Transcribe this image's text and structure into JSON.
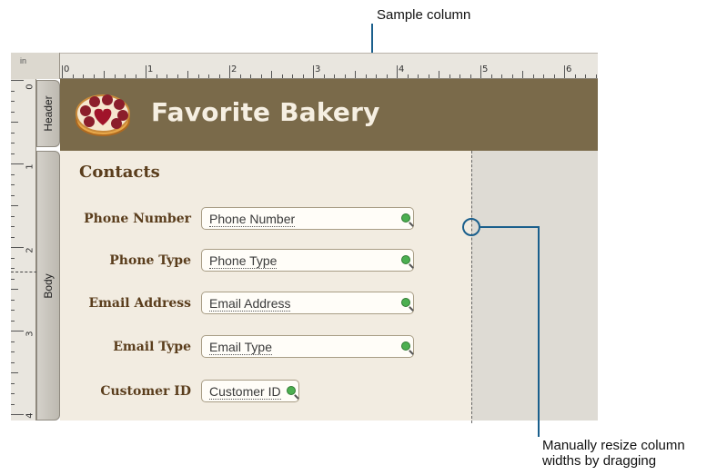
{
  "annotations": {
    "top_callout": "Sample column",
    "bottom_callout_line1": "Manually resize column",
    "bottom_callout_line2": "widths by dragging"
  },
  "ruler": {
    "unit": "in",
    "horizontal": [
      "0",
      "1",
      "2",
      "3",
      "4",
      "5",
      "6"
    ],
    "vertical": [
      "0",
      "1",
      "2",
      "3",
      "4"
    ]
  },
  "sections": {
    "header": "Header",
    "body": "Body"
  },
  "header": {
    "title": "Favorite Bakery",
    "logo_icon": "pie-icon"
  },
  "body": {
    "heading": "Contacts",
    "fields": [
      {
        "label": "Phone Number",
        "value": "Phone Number"
      },
      {
        "label": "Phone Type",
        "value": "Phone Type"
      },
      {
        "label": "Email Address",
        "value": "Email Address"
      },
      {
        "label": "Email Type",
        "value": "Email Type"
      },
      {
        "label": "Customer ID",
        "value": "Customer ID"
      }
    ]
  },
  "colors": {
    "header_band": "#7a6a4a",
    "body_bg": "#f2ece1",
    "label_text": "#5a3d1c",
    "callout_line": "#1a5f8c"
  }
}
